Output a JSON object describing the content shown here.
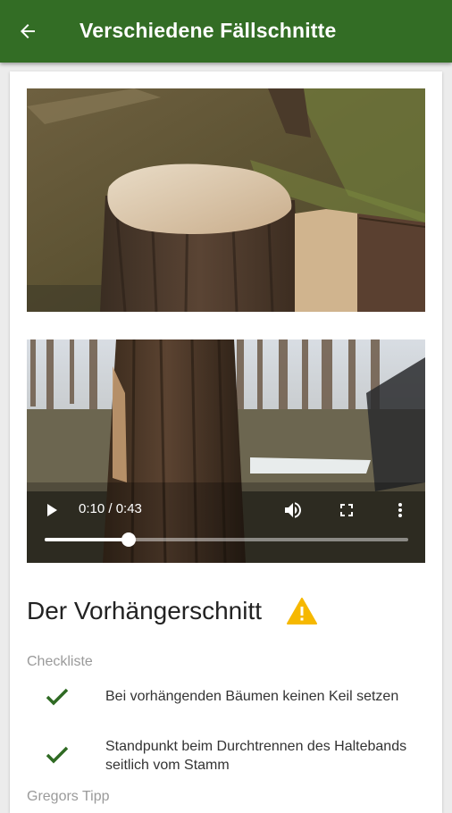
{
  "header": {
    "title": "Verschiedene Fällschnitte"
  },
  "video": {
    "current_time": "0:10",
    "duration": "0:43",
    "time_display": "0:10 / 0:43",
    "progress_fraction": 0.23
  },
  "section": {
    "title": "Der Vorhängerschnitt",
    "checklist_label": "Checkliste",
    "checklist": [
      "Bei vorhängenden Bäumen keinen Keil setzen",
      "Standpunkt beim Durchtrennen des Haltebands seitlich vom Stamm"
    ],
    "tip_label": "Gregors Tipp"
  },
  "colors": {
    "appbar": "#336d25",
    "check": "#2f6a23",
    "warning": "#f6b800"
  }
}
